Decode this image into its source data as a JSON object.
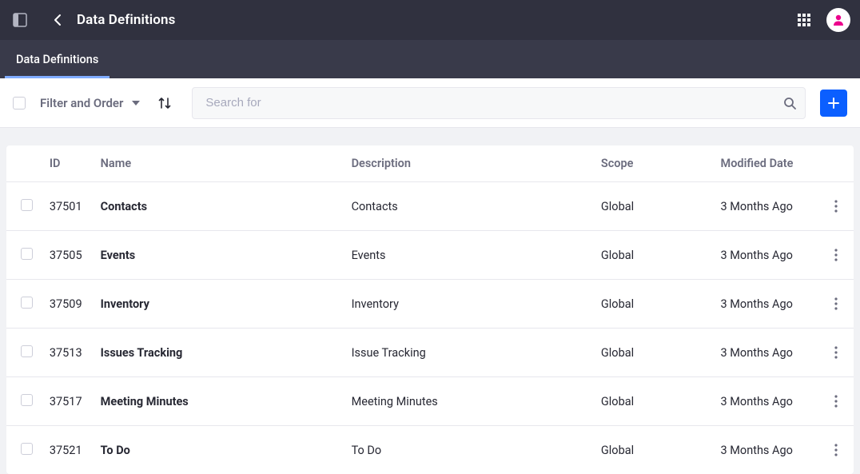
{
  "header": {
    "title": "Data Definitions"
  },
  "tabs": [
    {
      "label": "Data Definitions",
      "active": true
    }
  ],
  "toolbar": {
    "filter_label": "Filter and Order",
    "search_placeholder": "Search for"
  },
  "columns": {
    "id": "ID",
    "name": "Name",
    "description": "Description",
    "scope": "Scope",
    "modified": "Modified Date"
  },
  "rows": [
    {
      "id": "37501",
      "name": "Contacts",
      "description": "Contacts",
      "scope": "Global",
      "modified": "3 Months Ago"
    },
    {
      "id": "37505",
      "name": "Events",
      "description": "Events",
      "scope": "Global",
      "modified": "3 Months Ago"
    },
    {
      "id": "37509",
      "name": "Inventory",
      "description": "Inventory",
      "scope": "Global",
      "modified": "3 Months Ago"
    },
    {
      "id": "37513",
      "name": "Issues Tracking",
      "description": "Issue Tracking",
      "scope": "Global",
      "modified": "3 Months Ago"
    },
    {
      "id": "37517",
      "name": "Meeting Minutes",
      "description": "Meeting Minutes",
      "scope": "Global",
      "modified": "3 Months Ago"
    },
    {
      "id": "37521",
      "name": "To Do",
      "description": "To Do",
      "scope": "Global",
      "modified": "3 Months Ago"
    }
  ],
  "colors": {
    "accent": "#0b5fff",
    "avatar": "#ec008c"
  }
}
